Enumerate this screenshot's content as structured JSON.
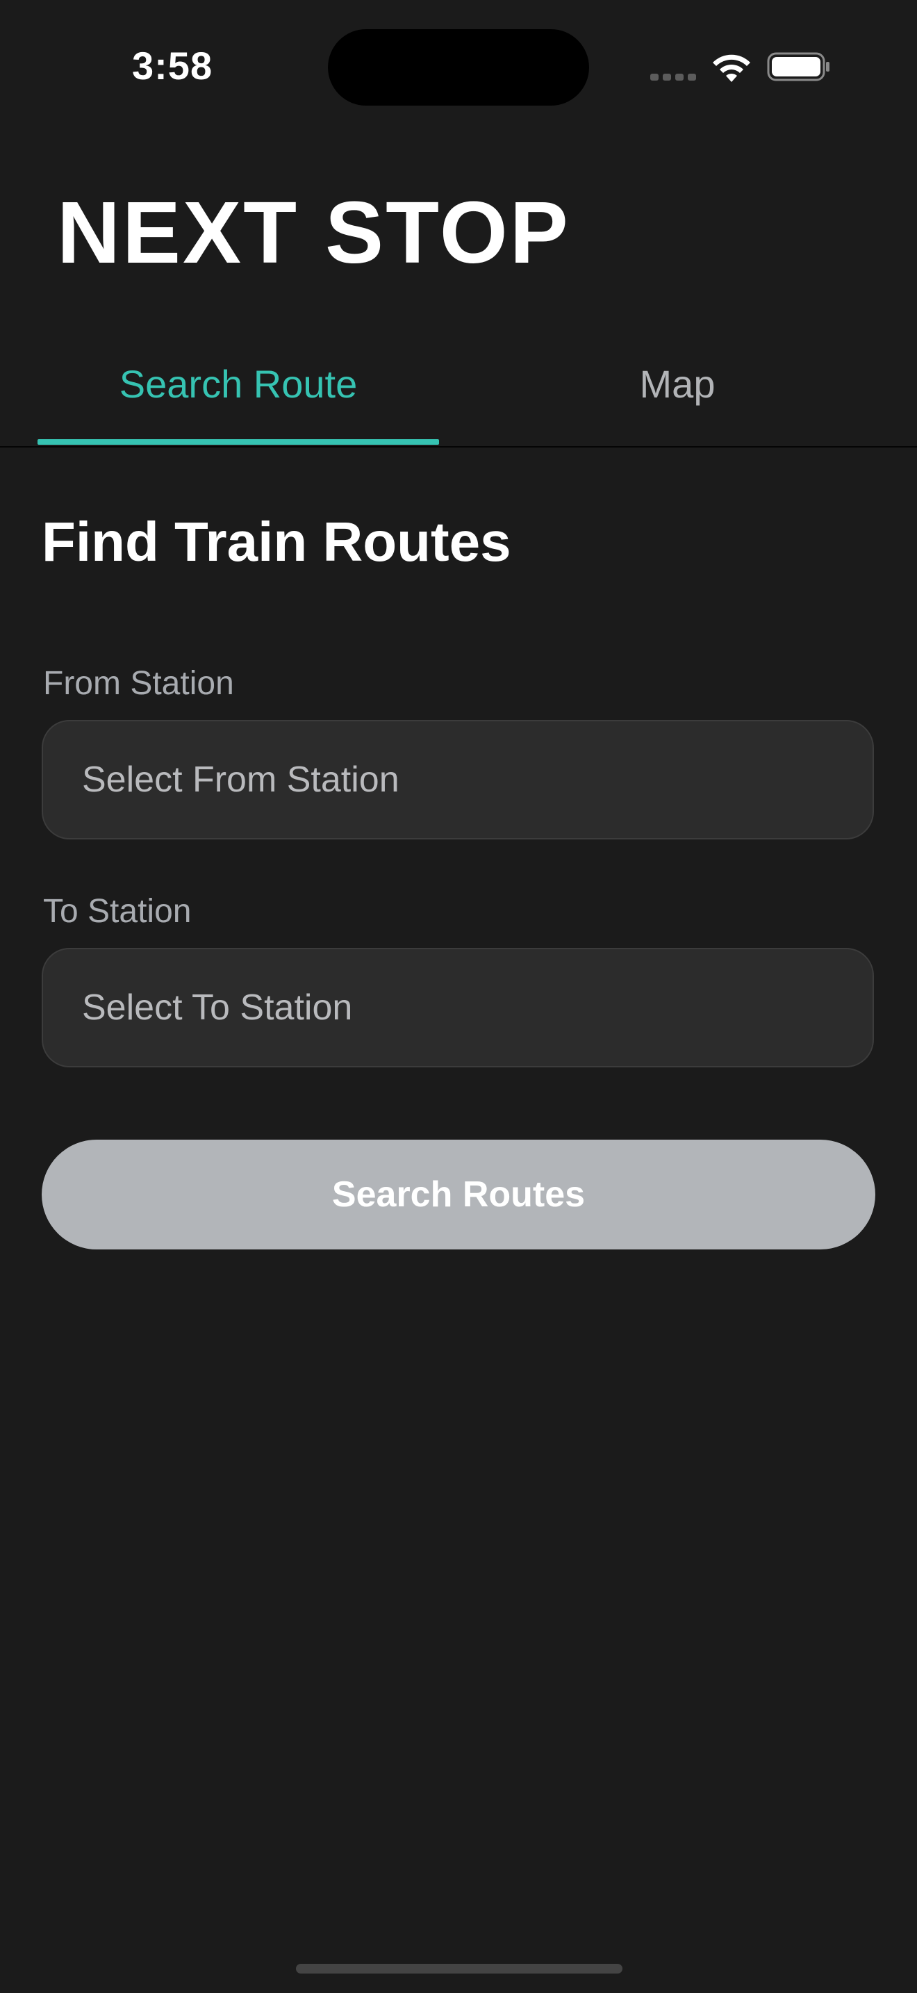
{
  "status_bar": {
    "time": "3:58"
  },
  "header": {
    "app_title": "NEXT STOP"
  },
  "tabs": [
    {
      "label": "Search Route",
      "active": true
    },
    {
      "label": "Map",
      "active": false
    }
  ],
  "main": {
    "section_title": "Find Train Routes",
    "from_field": {
      "label": "From Station",
      "placeholder": "Select From Station"
    },
    "to_field": {
      "label": "To Station",
      "placeholder": "Select To Station"
    },
    "search_button_label": "Search Routes"
  },
  "colors": {
    "background": "#1b1b1b",
    "accent": "#36c3b2",
    "field_background": "#2c2c2c",
    "button_disabled": "#b2b5b9"
  },
  "icons": [
    "cellular-signal-icon",
    "wifi-icon",
    "battery-icon"
  ]
}
